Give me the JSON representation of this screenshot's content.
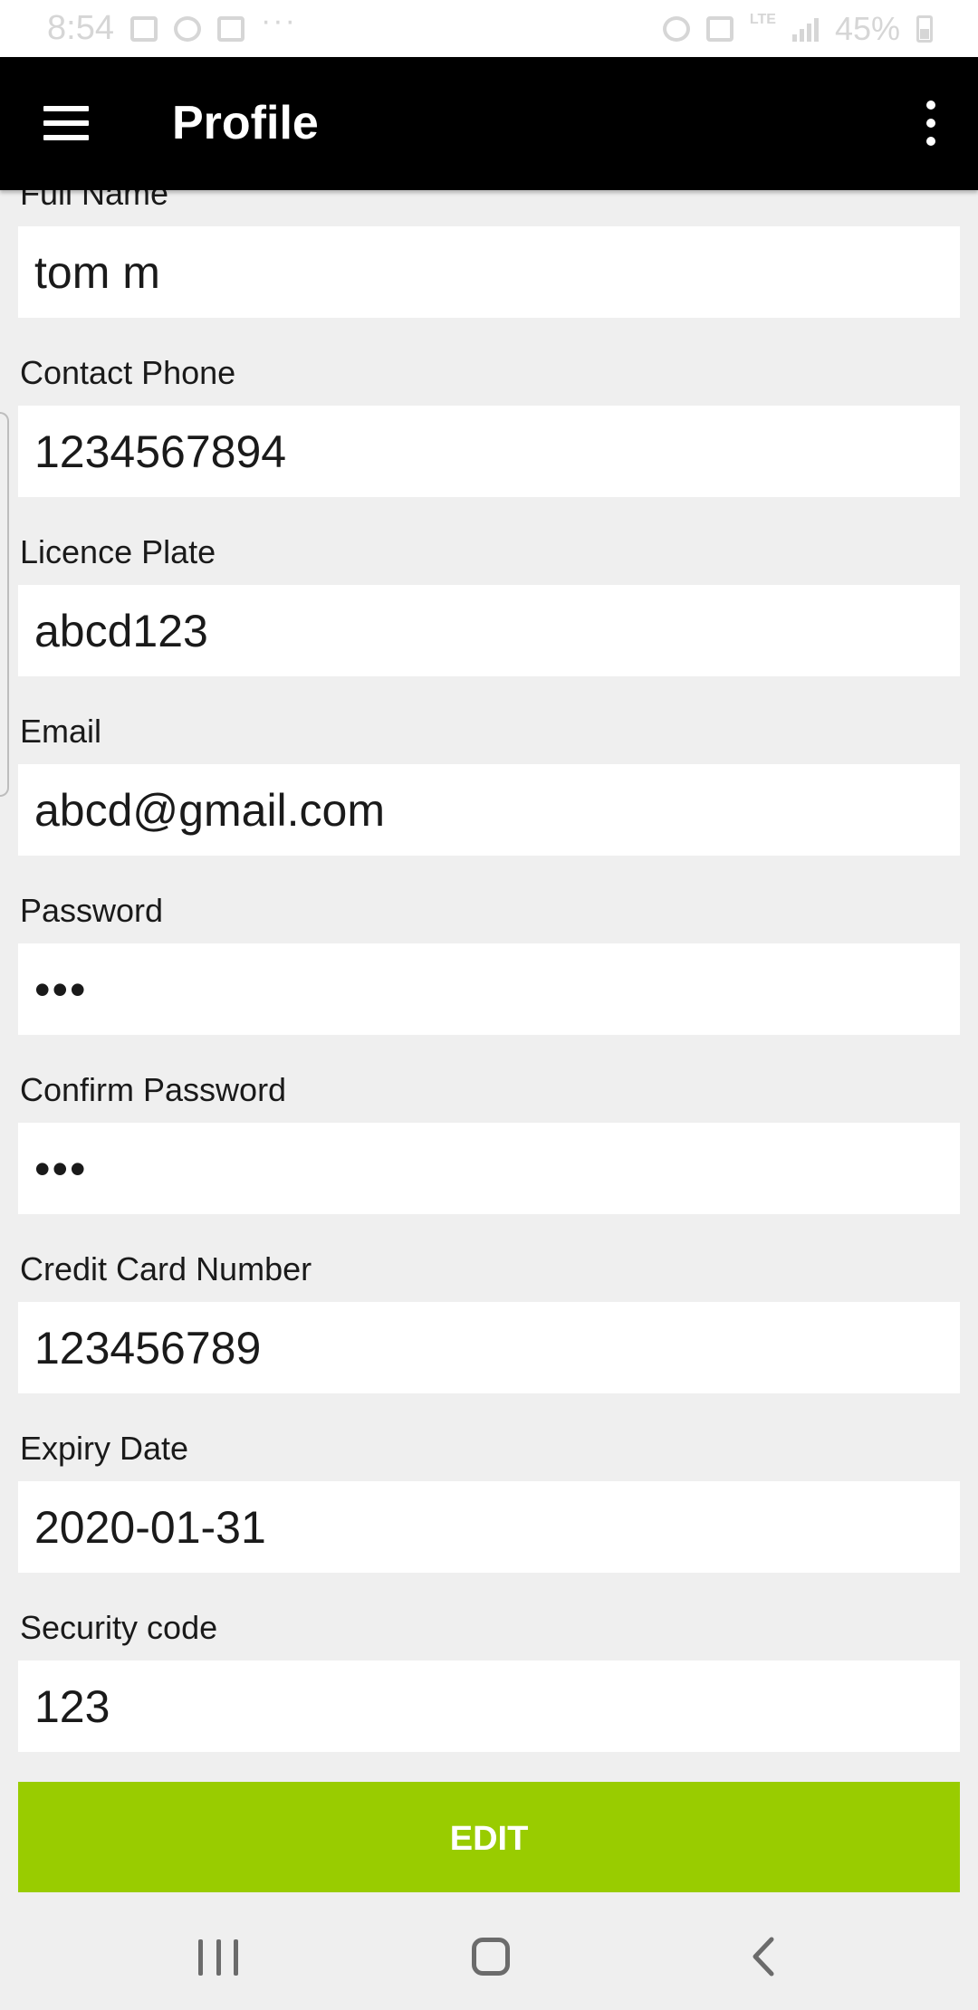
{
  "status_bar": {
    "time": "8:54",
    "dots": "···",
    "network": "LTE",
    "battery": "45%"
  },
  "app_bar": {
    "title": "Profile"
  },
  "form": {
    "fields": [
      {
        "label": "Full Name",
        "value": "tom m"
      },
      {
        "label": "Contact Phone",
        "value": "1234567894"
      },
      {
        "label": "Licence Plate",
        "value": "abcd123"
      },
      {
        "label": "Email",
        "value": "abcd@gmail.com"
      },
      {
        "label": "Password",
        "value": "•••"
      },
      {
        "label": "Confirm Password",
        "value": "•••"
      },
      {
        "label": "Credit Card Number",
        "value": "123456789"
      },
      {
        "label": "Expiry Date",
        "value": "2020-01-31"
      },
      {
        "label": "Security code",
        "value": "123"
      }
    ],
    "edit_button_label": "EDIT",
    "accent_color": "#99cc00"
  },
  "navigation": {
    "recents_icon": "recents-icon",
    "home_icon": "home-icon",
    "back_icon": "back-icon"
  }
}
